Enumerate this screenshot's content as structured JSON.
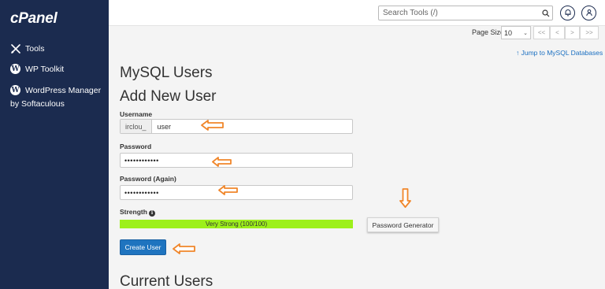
{
  "sidebar": {
    "logo": "cPanel",
    "items": [
      {
        "label": "Tools",
        "icon": "tools-icon"
      },
      {
        "label": "WP Toolkit",
        "icon": "wordpress-icon"
      },
      {
        "label": "WordPress Manager",
        "icon": "wordpress-icon"
      }
    ],
    "sub_label": "by Softaculous"
  },
  "topbar": {
    "search_placeholder": "Search Tools (/)",
    "icons": [
      "search-icon",
      "bell-icon",
      "user-icon"
    ]
  },
  "pagination": {
    "page_size_label": "Page Size",
    "page_size_value": "10",
    "buttons": [
      "<<",
      "<",
      ">",
      ">>"
    ]
  },
  "jump_link": "↑ Jump to MySQL Databases",
  "headings": {
    "main": "MySQL Users",
    "add": "Add New User",
    "current": "Current Users"
  },
  "form": {
    "username_label": "Username",
    "username_prefix": "irclou_",
    "username_value": "user",
    "password_label": "Password",
    "password_value": "••••••••••••",
    "password_again_label": "Password (Again)",
    "password_again_value": "••••••••••••",
    "strength_label": "Strength",
    "strength_text": "Very Strong (100/100)",
    "strength_percent": 100,
    "password_generator_label": "Password Generator",
    "create_label": "Create User"
  },
  "colors": {
    "sidebar": "#1b2b4f",
    "strength": "#9df01b",
    "primary": "#1f74bf",
    "annotation_arrow": "#f0862a",
    "link": "#1a6fc1"
  }
}
